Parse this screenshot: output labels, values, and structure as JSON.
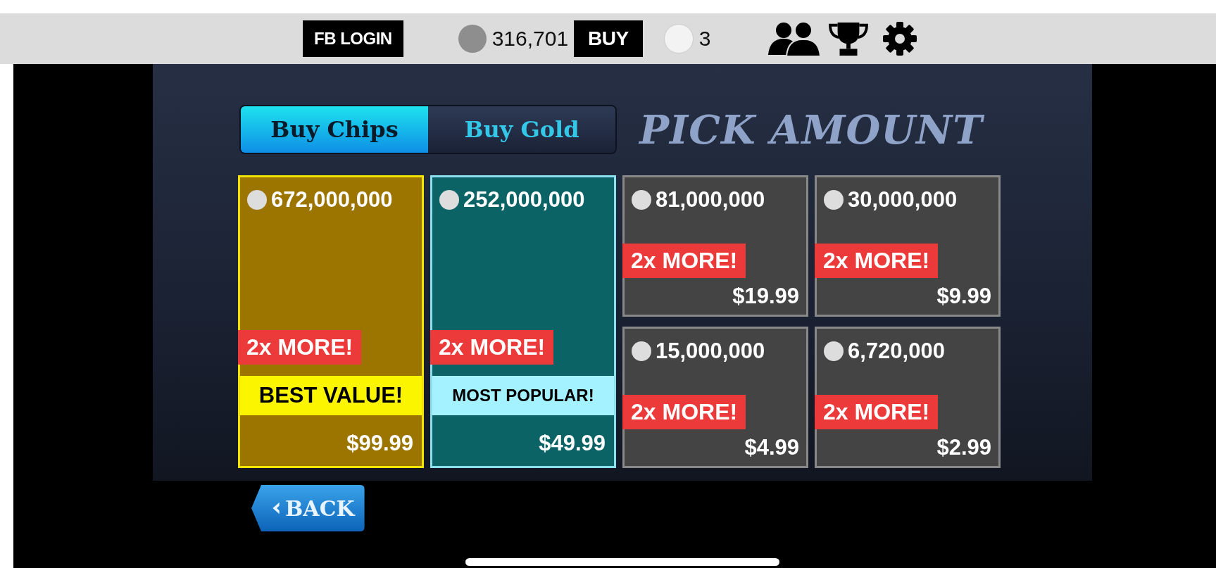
{
  "top_bar": {
    "login_button": "FB LOGIN",
    "chips": "316,701",
    "buy_button": "BUY",
    "gold": "3"
  },
  "tabs": [
    {
      "label": "Buy Chips",
      "selected": true
    },
    {
      "label": "Buy Gold",
      "selected": false
    }
  ],
  "heading": "PICK AMOUNT",
  "packages": [
    {
      "kind": "best",
      "amount": "672,000,000",
      "bonus": "2x MORE!",
      "tag": "BEST VALUE!",
      "price": "$99.99"
    },
    {
      "kind": "popular",
      "amount": "252,000,000",
      "bonus": "2x MORE!",
      "tag": "MOST POPULAR!",
      "price": "$49.99"
    },
    {
      "kind": "standard",
      "amount": "81,000,000",
      "bonus": "2x MORE!",
      "price": "$19.99"
    },
    {
      "kind": "standard",
      "amount": "30,000,000",
      "bonus": "2x MORE!",
      "price": "$9.99"
    },
    {
      "kind": "standard",
      "amount": "15,000,000",
      "bonus": "2x MORE!",
      "price": "$4.99"
    },
    {
      "kind": "standard",
      "amount": "6,720,000",
      "bonus": "2x MORE!",
      "price": "$2.99"
    }
  ],
  "back_button": "BACK"
}
